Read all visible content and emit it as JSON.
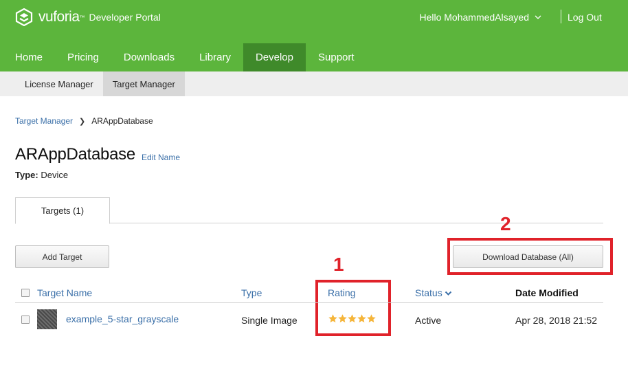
{
  "header": {
    "logo_word": "vuforia",
    "logo_tm": "™",
    "logo_sub": "Developer Portal",
    "user_greeting": "Hello MohammedAlsayed",
    "logout_label": "Log Out"
  },
  "main_nav": {
    "items": [
      {
        "label": "Home"
      },
      {
        "label": "Pricing"
      },
      {
        "label": "Downloads"
      },
      {
        "label": "Library"
      },
      {
        "label": "Develop"
      },
      {
        "label": "Support"
      }
    ],
    "active": "Develop"
  },
  "sub_nav": {
    "items": [
      {
        "label": "License Manager"
      },
      {
        "label": "Target Manager"
      }
    ],
    "active": "Target Manager"
  },
  "breadcrumb": {
    "parent": "Target Manager",
    "current": "ARAppDatabase"
  },
  "database": {
    "name": "ARAppDatabase",
    "edit_label": "Edit Name",
    "type_label": "Type:",
    "type_value": "Device"
  },
  "tabs": [
    {
      "label": "Targets (1)"
    }
  ],
  "actions": {
    "add_target_label": "Add Target",
    "download_label": "Download Database (All)"
  },
  "table": {
    "columns": {
      "name": "Target Name",
      "type": "Type",
      "rating": "Rating",
      "status": "Status",
      "date": "Date Modified"
    },
    "rows": [
      {
        "name": "example_5-star_grayscale",
        "type": "Single Image",
        "rating": 5,
        "status": "Active",
        "date": "Apr 28, 2018 21:52"
      }
    ]
  },
  "annotations": {
    "label_1": "1",
    "label_2": "2",
    "color": "#e0222a"
  },
  "colors": {
    "brand_green": "#5cb53c",
    "active_nav": "#3f8a2a",
    "link_blue": "#3a6fa8",
    "star_gold": "#f5b53a"
  }
}
